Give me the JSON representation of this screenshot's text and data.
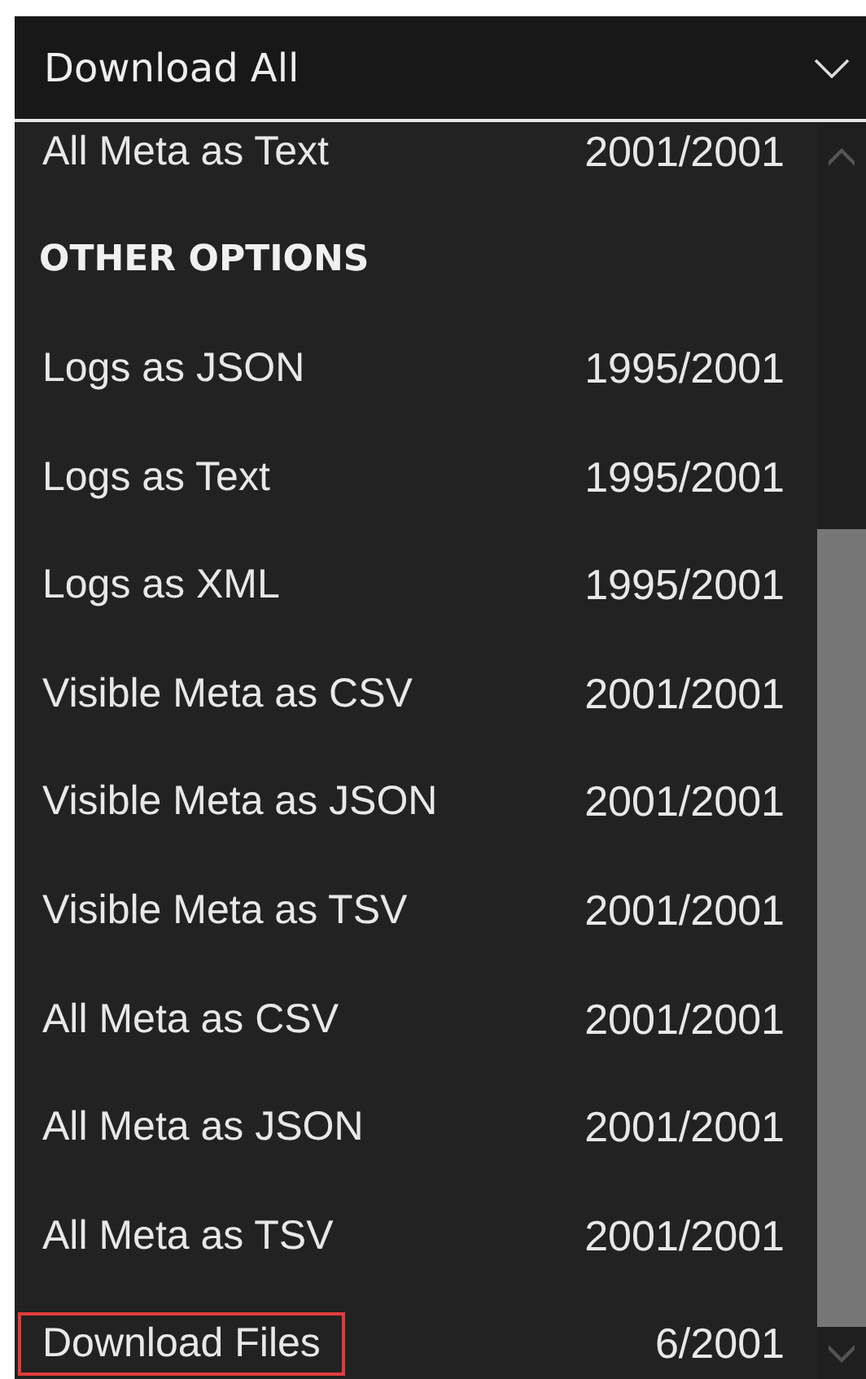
{
  "dropdown": {
    "title": "Download All"
  },
  "items": [
    {
      "kind": "item",
      "label": "All Meta as Text",
      "count": "2001/2001",
      "highlighted": false
    },
    {
      "kind": "header",
      "label": "OTHER OPTIONS"
    },
    {
      "kind": "item",
      "label": "Logs as JSON",
      "count": "1995/2001",
      "highlighted": false
    },
    {
      "kind": "item",
      "label": "Logs as Text",
      "count": "1995/2001",
      "highlighted": false
    },
    {
      "kind": "item",
      "label": "Logs as XML",
      "count": "1995/2001",
      "highlighted": false
    },
    {
      "kind": "item",
      "label": "Visible Meta as CSV",
      "count": "2001/2001",
      "highlighted": false
    },
    {
      "kind": "item",
      "label": "Visible Meta as JSON",
      "count": "2001/2001",
      "highlighted": false
    },
    {
      "kind": "item",
      "label": "Visible Meta as TSV",
      "count": "2001/2001",
      "highlighted": false
    },
    {
      "kind": "item",
      "label": "All Meta as CSV",
      "count": "2001/2001",
      "highlighted": false
    },
    {
      "kind": "item",
      "label": "All Meta as JSON",
      "count": "2001/2001",
      "highlighted": false
    },
    {
      "kind": "item",
      "label": "All Meta as TSV",
      "count": "2001/2001",
      "highlighted": false
    },
    {
      "kind": "item",
      "label": "Download Files",
      "count": "6/2001",
      "highlighted": true
    }
  ]
}
